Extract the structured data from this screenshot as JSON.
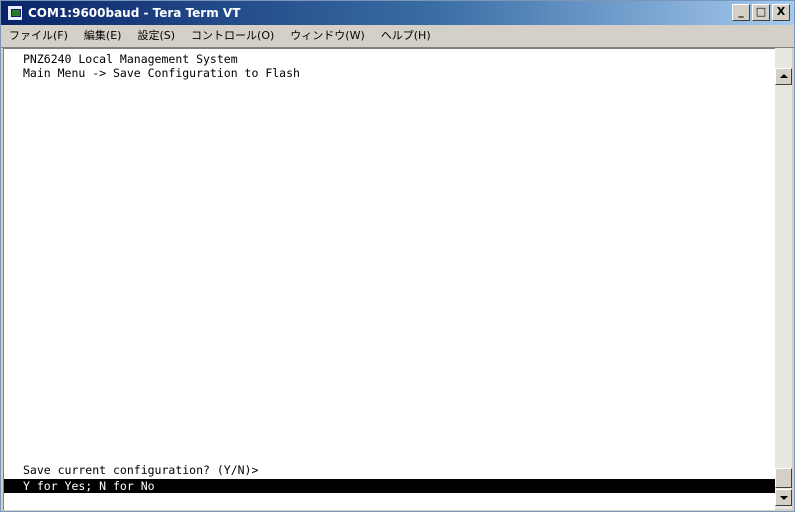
{
  "window": {
    "title": "COM1:9600baud - Tera Term VT",
    "buttons": {
      "minimize": "_",
      "maximize": "□",
      "close": "X"
    }
  },
  "menubar": {
    "items": [
      "ファイル(F)",
      "編集(E)",
      "設定(S)",
      "コントロール(O)",
      "ウィンドウ(W)",
      "ヘルプ(H)"
    ]
  },
  "terminal": {
    "lines": [
      "PNZ6240 Local Management System",
      "Main Menu -> Save Configuration to Flash"
    ],
    "prompt": "Save current configuration? (Y/N)>",
    "status": "Y for Yes; N for No"
  },
  "colors": {
    "terminal_background": "#ffffff",
    "terminal_text": "#000000",
    "status_background": "#000000",
    "status_text": "#ffffff"
  }
}
